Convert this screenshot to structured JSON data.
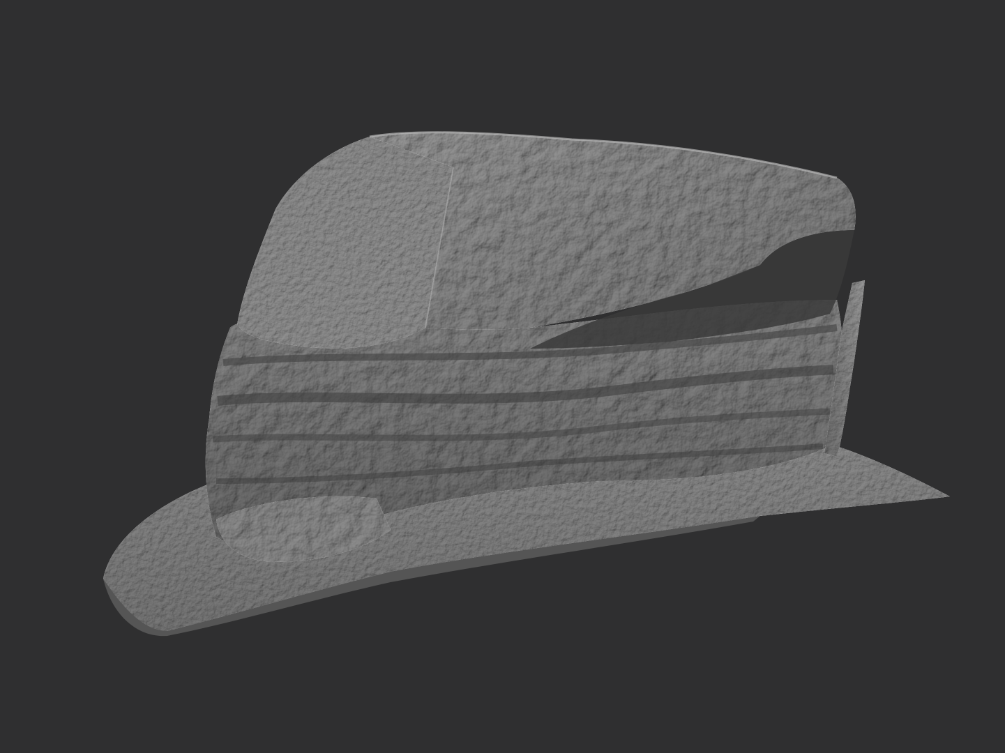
{
  "scene": {
    "background_color": "#2f2f30",
    "model_color": "#7f7f7f",
    "subject": "rock-scan-sculpt"
  }
}
